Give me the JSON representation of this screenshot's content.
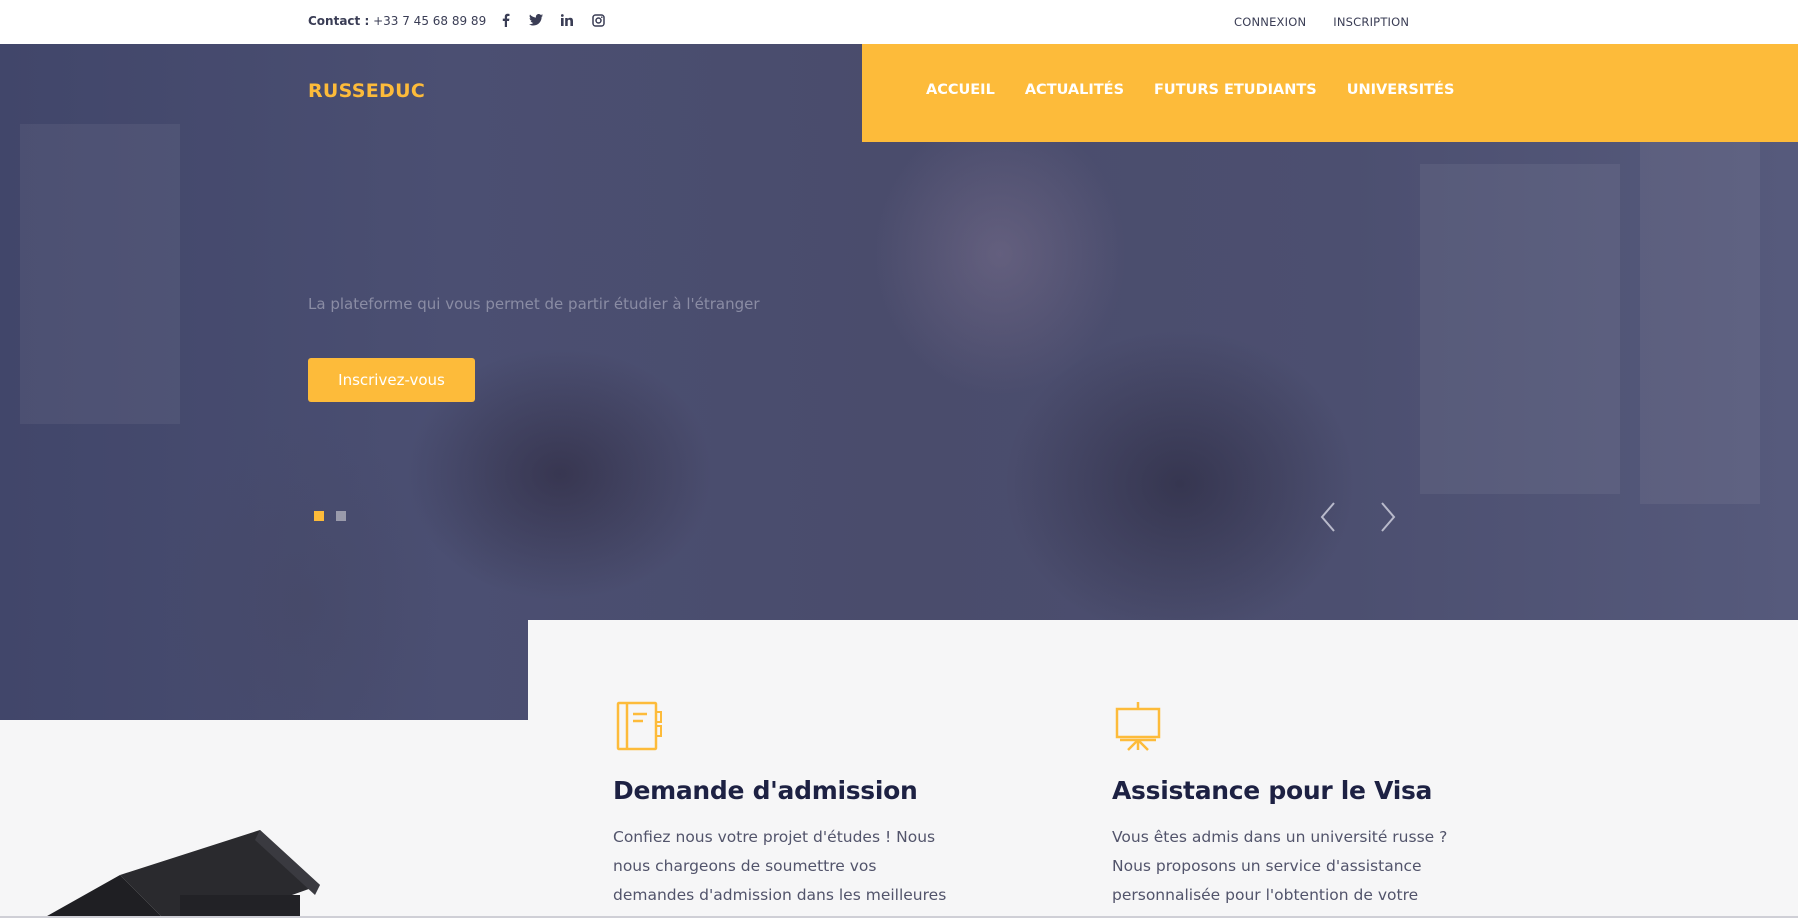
{
  "topbar": {
    "contact_label": "Contact :",
    "contact_phone": "+33 7 45 68 89 89",
    "social": [
      "facebook-icon",
      "twitter-icon",
      "linkedin-icon",
      "instagram-icon"
    ],
    "login": "CONNEXION",
    "signup": "INSCRIPTION"
  },
  "brand": {
    "logo": "RUSSEDUC"
  },
  "nav": {
    "items": [
      "ACCUEIL",
      "ACTUALITÉS",
      "FUTURS ETUDIANTS",
      "UNIVERSITÉS"
    ],
    "active": "ACCUEIL"
  },
  "hero": {
    "tagline": "La plateforme qui vous permet de partir étudier à l'étranger",
    "cta": "Inscrivez-vous",
    "slides_count": 2,
    "active_slide": 1
  },
  "features": [
    {
      "icon": "notebook-icon",
      "title": "Demande d'admission",
      "text": "Confiez nous votre projet d'études ! Nous nous chargeons de soumettre vos demandes d'admission dans les meilleures"
    },
    {
      "icon": "presentation-board-icon",
      "title": "Assistance pour le Visa",
      "text": "Vous êtes admis dans un université russe ? Nous proposons un service d'assistance personnalisée pour l'obtention de votre"
    }
  ],
  "colors": {
    "accent": "#fdbb3a",
    "heading": "#1d2143",
    "overlay": "#4a4d6e"
  }
}
